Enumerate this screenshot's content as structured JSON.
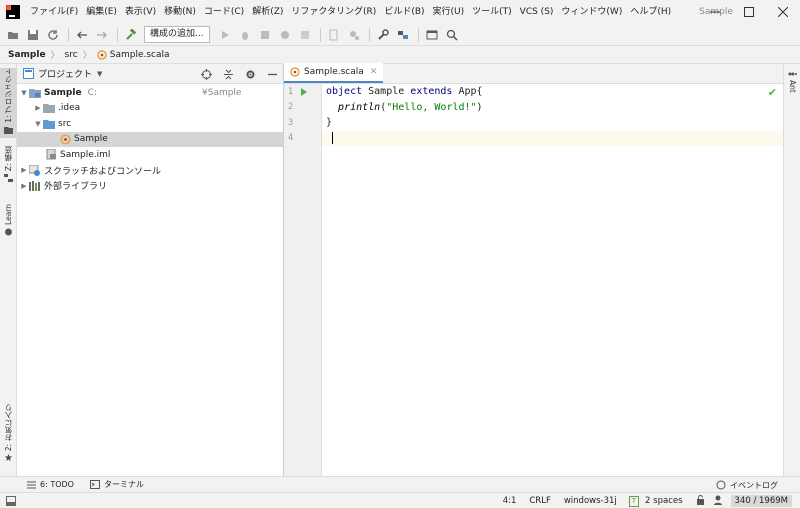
{
  "menubar": {
    "items": [
      "ファイル(F)",
      "編集(E)",
      "表示(V)",
      "移動(N)",
      "コード(C)",
      "解析(Z)",
      "リファクタリング(R)",
      "ビルド(B)",
      "実行(U)",
      "ツール(T)",
      "VCS (S)",
      "ウィンドウ(W)",
      "ヘルプ(H)"
    ],
    "window_title": "Sample"
  },
  "toolbar": {
    "config_label": "構成の追加..."
  },
  "breadcrumb": {
    "items": [
      "Sample",
      "src",
      "Sample.scala"
    ]
  },
  "left_stripe": {
    "project_tab": "1: プロジェクト",
    "structure_tab": "Z: 構造",
    "learn_tab": "Learn",
    "favorites_tab": "2: お気に入り"
  },
  "right_stripe": {
    "ant_tab": "Ant"
  },
  "project_panel": {
    "title": "プロジェクト",
    "tree": [
      {
        "label": "Sample",
        "hint": "C:",
        "hint_right": "¥Sample",
        "icon": "module-folder-icon"
      },
      {
        "label": ".idea",
        "icon": "folder-icon"
      },
      {
        "label": "src",
        "icon": "source-folder-icon"
      },
      {
        "label": "Sample",
        "icon": "scala-object-icon"
      },
      {
        "label": "Sample.iml",
        "icon": "iml-file-icon"
      },
      {
        "label": "スクラッチおよびコンソール",
        "icon": "scratch-icon"
      },
      {
        "label": "外部ライブラリ",
        "icon": "library-icon"
      }
    ]
  },
  "editor": {
    "tab_label": "Sample.scala",
    "line_numbers": [
      "1",
      "2",
      "3",
      "4"
    ],
    "code": {
      "l1_kw1": "object",
      "l1_name": " Sample ",
      "l1_kw2": "extends",
      "l1_rest": " App{",
      "l2_indent": "  ",
      "l2_fn": "println",
      "l2_open": "(",
      "l2_str": "\"Hello, World!\"",
      "l2_close": ")",
      "l3": "}"
    }
  },
  "bottom_tools": {
    "todo": "6: TODO",
    "terminal": "ターミナル",
    "event_log": "イベントログ"
  },
  "statusbar": {
    "position": "4:1",
    "line_sep": "CRLF",
    "encoding": "windows-31j",
    "indent": "2 spaces",
    "memory": "340 / 1969M"
  },
  "colors": {
    "keyword": "#000080",
    "string": "#008000",
    "run_marker": "#4caf50",
    "tab_underline": "#4a88c7"
  }
}
